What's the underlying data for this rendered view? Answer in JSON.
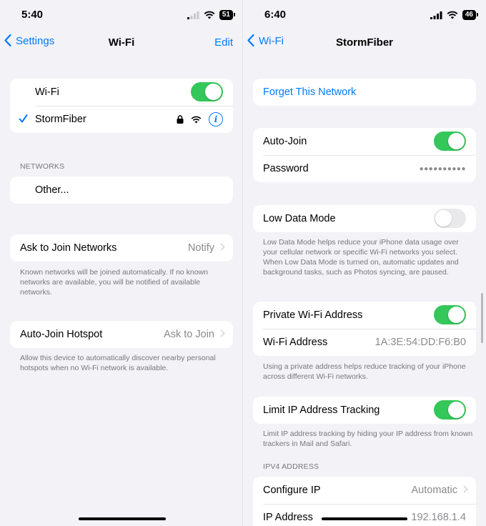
{
  "left": {
    "time": "5:40",
    "battery": "51",
    "nav": {
      "back": "Settings",
      "title": "Wi-Fi",
      "edit": "Edit"
    },
    "wifi_label": "Wi-Fi",
    "wifi_on": true,
    "current_network": "StormFiber",
    "networks_header": "NETWORKS",
    "other": "Other...",
    "ask_join": {
      "label": "Ask to Join Networks",
      "value": "Notify"
    },
    "ask_join_note": "Known networks will be joined automatically. If no known networks are available, you will be notified of available networks.",
    "hotspot": {
      "label": "Auto-Join Hotspot",
      "value": "Ask to Join"
    },
    "hotspot_note": "Allow this device to automatically discover nearby personal hotspots when no Wi-Fi network is available."
  },
  "right": {
    "time": "6:40",
    "battery": "46",
    "nav": {
      "back": "Wi-Fi",
      "title": "StormFiber"
    },
    "forget": "Forget This Network",
    "auto_join": "Auto-Join",
    "password": {
      "label": "Password",
      "value": "●●●●●●●●●●"
    },
    "low_data": "Low Data Mode",
    "low_data_note": "Low Data Mode helps reduce your iPhone data usage over your cellular network or specific Wi-Fi networks you select. When Low Data Mode is turned on, automatic updates and background tasks, such as Photos syncing, are paused.",
    "private_addr": "Private Wi-Fi Address",
    "wifi_addr": {
      "label": "Wi-Fi Address",
      "value": "1A:3E:54:DD:F6:B0"
    },
    "private_note": "Using a private address helps reduce tracking of your iPhone across different Wi-Fi networks.",
    "limit_ip": "Limit IP Address Tracking",
    "limit_note": "Limit IP address tracking by hiding your IP address from known trackers in Mail and Safari.",
    "ipv4_header": "IPV4 ADDRESS",
    "configure_ip": {
      "label": "Configure IP",
      "value": "Automatic"
    },
    "ip_address": {
      "label": "IP Address",
      "value": "192.168.1.4"
    }
  },
  "colors": {
    "accent": "#007aff",
    "toggle_on": "#34c759",
    "background": "#f2f2f7"
  }
}
